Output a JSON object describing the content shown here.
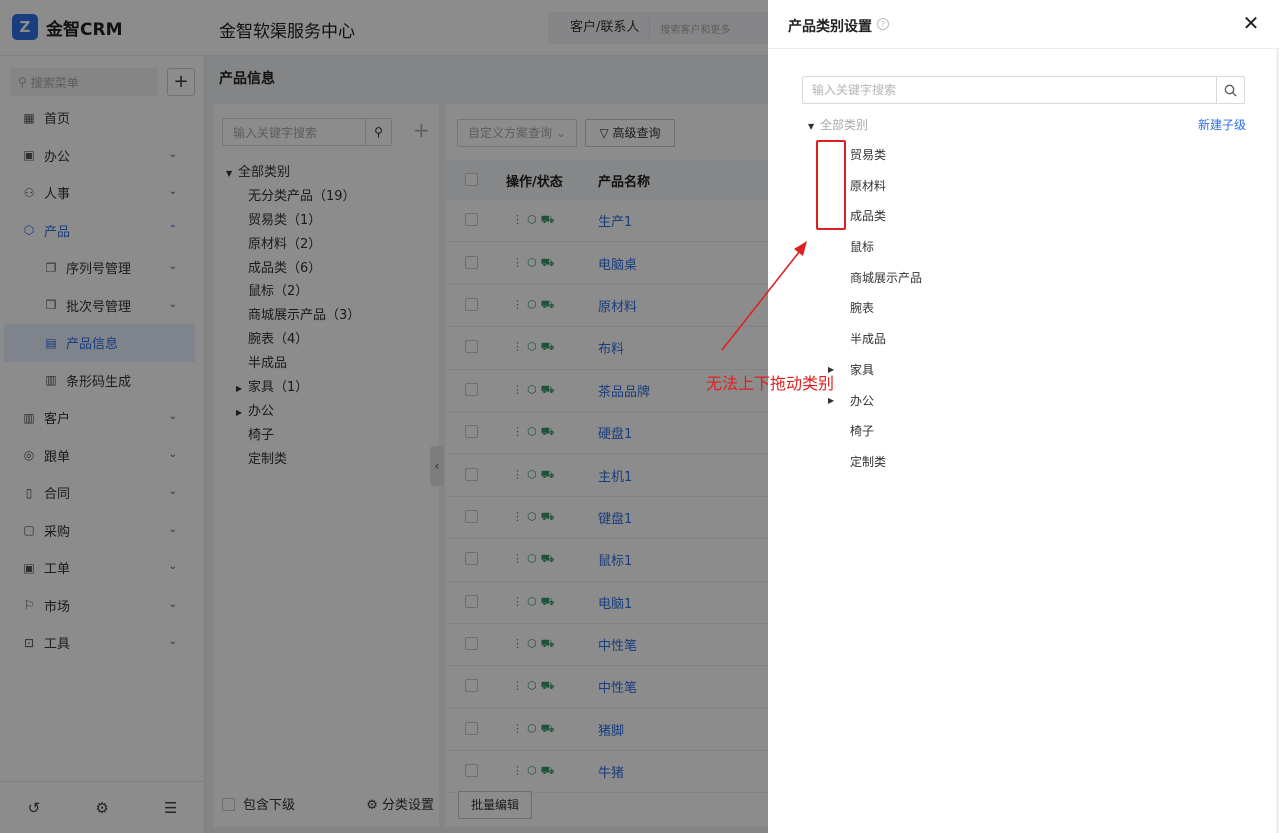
{
  "app": {
    "logo_text": "金智CRM",
    "logo_mark": "Z",
    "org_title": "金智软渠服务中心",
    "search_scope": "客户/联系人",
    "search_placeholder": "搜索客户和更多"
  },
  "sidebar": {
    "search_placeholder": "搜索菜单",
    "items": [
      {
        "label": "首页",
        "icon": "home-icon"
      },
      {
        "label": "办公",
        "icon": "office-icon"
      },
      {
        "label": "人事",
        "icon": "people-icon"
      },
      {
        "label": "产品",
        "icon": "product-icon"
      },
      {
        "label": "序列号管理",
        "icon": "copy-icon"
      },
      {
        "label": "批次号管理",
        "icon": "copy-icon"
      },
      {
        "label": "产品信息",
        "icon": "doc-icon"
      },
      {
        "label": "条形码生成",
        "icon": "barcode-icon"
      },
      {
        "label": "客户",
        "icon": "building-icon"
      },
      {
        "label": "跟单",
        "icon": "target-icon"
      },
      {
        "label": "合同",
        "icon": "contract-icon"
      },
      {
        "label": "采购",
        "icon": "cart-icon"
      },
      {
        "label": "工单",
        "icon": "ticket-icon"
      },
      {
        "label": "市场",
        "icon": "flag-icon"
      },
      {
        "label": "工具",
        "icon": "toolbox-icon"
      }
    ],
    "bottom_icons": [
      "history-icon",
      "settings-sliders-icon",
      "collapse-menu-icon"
    ]
  },
  "page": {
    "title": "产品信息",
    "category_search_placeholder": "输入关键字搜索",
    "categories": [
      {
        "label": "全部类别"
      },
      {
        "label": "无分类产品（19）"
      },
      {
        "label": "贸易类（1）"
      },
      {
        "label": "原材料（2）"
      },
      {
        "label": "成品类（6）"
      },
      {
        "label": "鼠标（2）"
      },
      {
        "label": "商城展示产品（3）"
      },
      {
        "label": "腕表（4）"
      },
      {
        "label": "半成品"
      },
      {
        "label": "家具（1）"
      },
      {
        "label": "办公"
      },
      {
        "label": "椅子"
      },
      {
        "label": "定制类"
      }
    ],
    "include_sub_label": "包含下级",
    "category_settings_label": "分类设置",
    "custom_query_placeholder": "自定义方案查询",
    "advanced_query_label": "高级查询",
    "table_headers": {
      "op": "操作/状态",
      "name": "产品名称"
    },
    "rows": [
      "生产1",
      "电脑桌",
      "原材料",
      "布料",
      "茶品品牌",
      "硬盘1",
      "主机1",
      "键盘1",
      "鼠标1",
      "电脑1",
      "中性笔",
      "中性笔",
      "猪脚",
      "牛猪"
    ],
    "bulk_edit_label": "批量编辑"
  },
  "drawer": {
    "title": "产品类别设置",
    "search_placeholder": "输入关键字搜索",
    "root_label": "全部类别",
    "new_child_label": "新建子级",
    "nodes": [
      {
        "label": "贸易类",
        "has_children": false
      },
      {
        "label": "原材料",
        "has_children": false
      },
      {
        "label": "成品类",
        "has_children": false
      },
      {
        "label": "鼠标",
        "has_children": false
      },
      {
        "label": "商城展示产品",
        "has_children": false
      },
      {
        "label": "腕表",
        "has_children": false
      },
      {
        "label": "半成品",
        "has_children": false
      },
      {
        "label": "家具",
        "has_children": true
      },
      {
        "label": "办公",
        "has_children": true
      },
      {
        "label": "椅子",
        "has_children": false
      },
      {
        "label": "定制类",
        "has_children": false
      }
    ]
  },
  "annotation": {
    "text": "无法上下拖动类别",
    "color": "#e02020"
  },
  "colors": {
    "accent": "#2f6fe4",
    "status_green": "#3b9a6b"
  }
}
